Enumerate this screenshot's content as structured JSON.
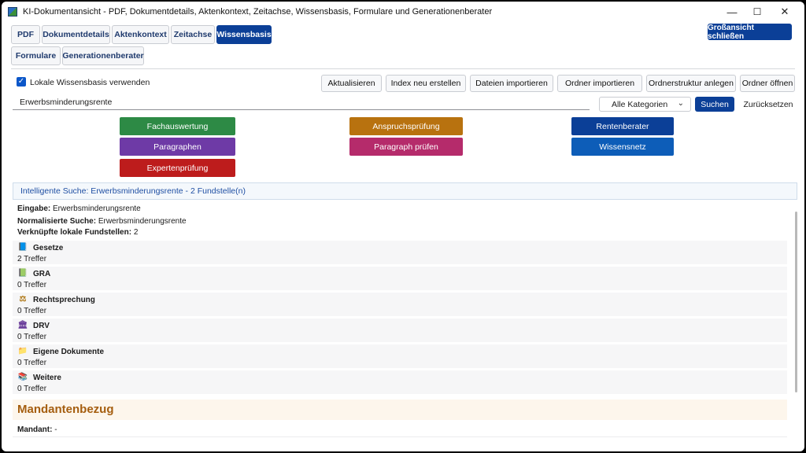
{
  "window": {
    "title": "KI-Dokumentansicht - PDF, Dokumentdetails, Aktenkontext, Zeitachse, Wissensbasis, Formulare und Generationenberater",
    "controls": {
      "minimize": "—",
      "maximize": "☐",
      "close": "✕"
    }
  },
  "tabs": [
    {
      "label": "PDF"
    },
    {
      "label": "Dokumentdetails"
    },
    {
      "label": "Aktenkontext"
    },
    {
      "label": "Zeitachse"
    },
    {
      "label": "Wissensbasis",
      "active": true
    },
    {
      "label": "Formulare"
    },
    {
      "label": "Generationenberater"
    }
  ],
  "header": {
    "close_fullscreen": "Großansicht schließen"
  },
  "toolbar": {
    "checkbox_label": "Lokale Wissensbasis verwenden",
    "checkbox_checked": true,
    "checkmark": "✓",
    "buttons": [
      "Aktualisieren",
      "Index neu erstellen",
      "Dateien importieren",
      "Ordner importieren",
      "Ordnerstruktur anlegen",
      "Ordner öffnen"
    ]
  },
  "search": {
    "value": "Erwerbsminderungsrente",
    "category": "Alle Kategorien",
    "chevron": "⌄",
    "search_label": "Suchen",
    "reset_label": "Zurücksetzen"
  },
  "actions": [
    {
      "label": "Fachauswertung",
      "color": "#2d8a45"
    },
    {
      "label": "Anspruchsprüfung",
      "color": "#b8720f"
    },
    {
      "label": "Rentenberater",
      "color": "#0b3f97"
    },
    {
      "label": "Paragraphen",
      "color": "#6e3aa6"
    },
    {
      "label": "Paragraph prüfen",
      "color": "#b52b6b"
    },
    {
      "label": "Wissensnetz",
      "color": "#0d5db8"
    },
    {
      "label": "Expertenprüfung",
      "color": "#bd1c1c"
    }
  ],
  "results": {
    "header": "Intelligente Suche: Erwerbsminderungsrente - 2 Fundstelle(n)",
    "input_label": "Eingabe:",
    "input_value": "Erwerbsminderungsrente",
    "normalized_label": "Normalisierte Suche:",
    "normalized_value": "Erwerbsminderungsrente",
    "linked_label": "Verknüpfte lokale Fundstellen:",
    "linked_value": "2",
    "categories": [
      {
        "icon": "📘",
        "icon_name": "blue-book-icon",
        "name": "Gesetze",
        "count": "2 Treffer"
      },
      {
        "icon": "📗",
        "icon_name": "green-book-icon",
        "name": "GRA",
        "count": "0 Treffer"
      },
      {
        "icon": "⚖",
        "icon_name": "scales-icon",
        "name": "Rechtsprechung",
        "count": "0 Treffer"
      },
      {
        "icon": "🏛",
        "icon_name": "institution-icon",
        "name": "DRV",
        "count": "0 Treffer"
      },
      {
        "icon": "📁",
        "icon_name": "folder-icon",
        "name": "Eigene Dokumente",
        "count": "0 Treffer"
      },
      {
        "icon": "📚",
        "icon_name": "books-icon",
        "name": "Weitere",
        "count": "0 Treffer"
      }
    ]
  },
  "client": {
    "title": "Mandantenbezug",
    "label": "Mandant:",
    "value": "-"
  }
}
